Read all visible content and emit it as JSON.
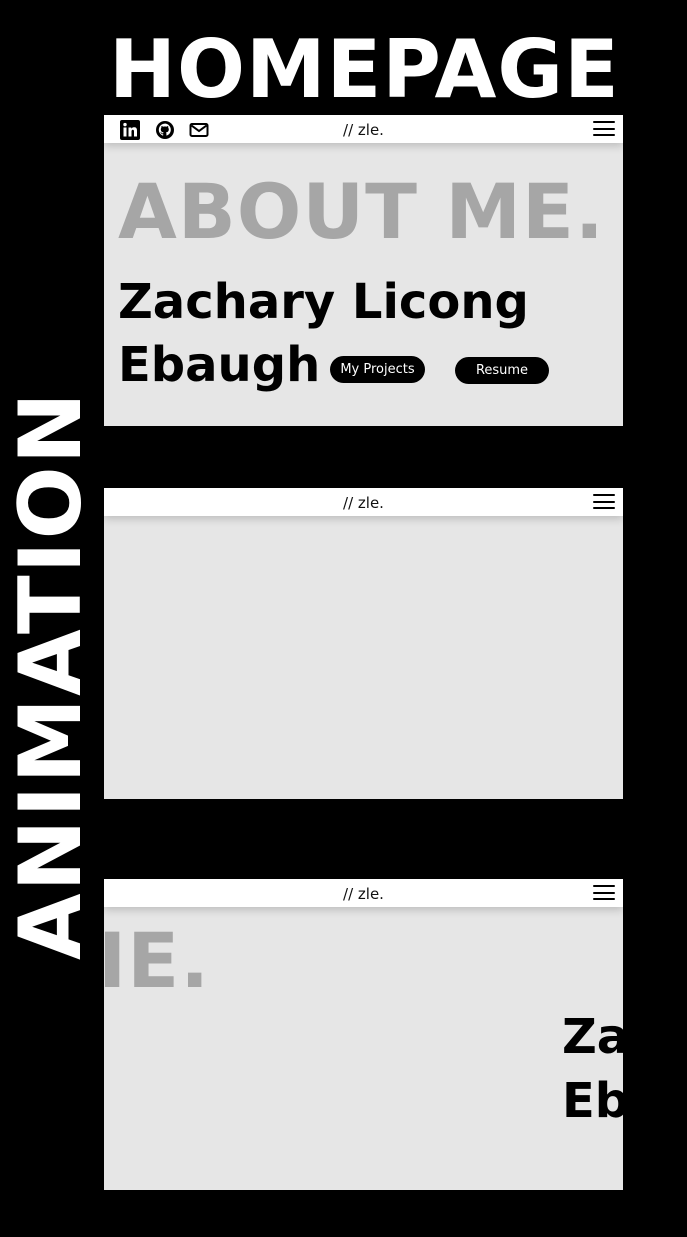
{
  "headings": {
    "top": "HOMEPAGE",
    "side": "ANIMATION"
  },
  "navbar": {
    "brand": "// zle."
  },
  "social_icons": [
    "linkedin-icon",
    "github-icon",
    "mail-icon"
  ],
  "hero": {
    "title": "ABOUT ME.",
    "name_line_1": "Zachary Licong",
    "name_line_2": "Ebaugh",
    "projects_button": "My Projects",
    "resume_button": "Resume"
  },
  "animation_frame": {
    "title_fragment": "IE.",
    "name_fragment_1": "Za",
    "name_fragment_2": "Eb"
  },
  "colors": {
    "background": "#000000",
    "frame": "#e6e6e6",
    "navbar": "#ffffff",
    "title_gray": "#a6a6a6",
    "text": "#000000"
  }
}
